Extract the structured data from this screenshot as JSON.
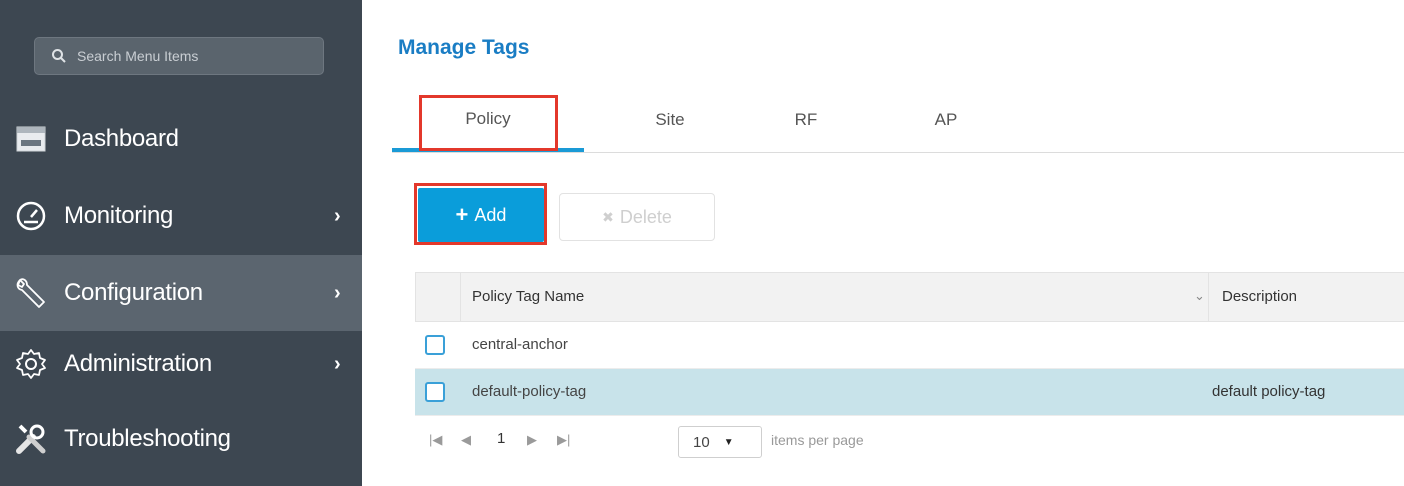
{
  "sidebar": {
    "search_placeholder": "Search Menu Items",
    "items": [
      {
        "label": "Dashboard",
        "icon": "dashboard-icon",
        "chevron": ""
      },
      {
        "label": "Monitoring",
        "icon": "monitoring-gauge-icon",
        "chevron": "›"
      },
      {
        "label": "Configuration",
        "icon": "wrench-icon",
        "chevron": "›"
      },
      {
        "label": "Administration",
        "icon": "gear-icon",
        "chevron": "›"
      },
      {
        "label": "Troubleshooting",
        "icon": "tools-icon",
        "chevron": ""
      }
    ],
    "active_item": "Configuration"
  },
  "main": {
    "title": "Manage Tags",
    "tabs": [
      {
        "label": "Policy"
      },
      {
        "label": "Site"
      },
      {
        "label": "RF"
      },
      {
        "label": "AP"
      }
    ],
    "active_tab": "Policy",
    "add_label": "Add",
    "delete_label": "Delete",
    "table": {
      "columns": [
        "Policy Tag Name",
        "Description"
      ],
      "rows": [
        {
          "name": "central-anchor",
          "description": ""
        },
        {
          "name": "default-policy-tag",
          "description": "default policy-tag"
        }
      ]
    },
    "pager": {
      "page": "1",
      "per_page": "10",
      "per_page_label": "items per page"
    }
  },
  "colors": {
    "sidebar_bg": "#3d4751",
    "accent": "#1a9ad6",
    "highlight_box": "#e3382b",
    "selected_row": "#c8e3ea"
  }
}
